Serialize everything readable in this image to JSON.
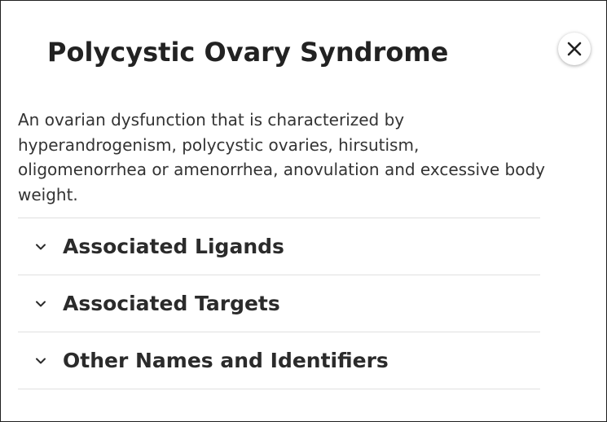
{
  "dialog": {
    "title": "Polycystic Ovary Syndrome",
    "close_icon": "close-x-icon",
    "description": "An ovarian dysfunction that is characterized by hyperandrogenism, polycystic ovaries, hirsutism, oligomenorrhea or amenorrhea, anovulation and excessive body weight."
  },
  "accordion": {
    "chevron_icon": "chevron-down-icon",
    "items": [
      {
        "label": "Associated Ligands"
      },
      {
        "label": "Associated Targets"
      },
      {
        "label": "Other Names and Identifiers"
      }
    ]
  }
}
